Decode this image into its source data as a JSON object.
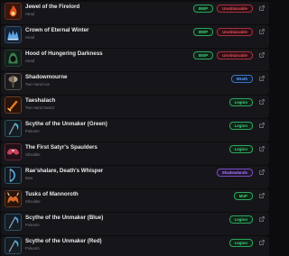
{
  "items": [
    {
      "name": "Jewel of the Firelord",
      "type": "Head",
      "badges": [
        {
          "label": "BWP",
          "color": "green"
        },
        {
          "label": "Unobtainable",
          "color": "red"
        }
      ],
      "icon": "flame-gem-icon",
      "accent": "#e0521f"
    },
    {
      "name": "Crown of Eternal Winter",
      "type": "Head",
      "badges": [
        {
          "label": "BWP",
          "color": "green"
        },
        {
          "label": "Unobtainable",
          "color": "red"
        }
      ],
      "icon": "frost-crown-icon",
      "accent": "#5fa8e8"
    },
    {
      "name": "Hood of Hungering Darkness",
      "type": "Head",
      "badges": [
        {
          "label": "BWP",
          "color": "green"
        },
        {
          "label": "Unobtainable",
          "color": "red"
        }
      ],
      "icon": "shadow-hood-icon",
      "accent": "#3b7d4a"
    },
    {
      "name": "Shadowmourne",
      "type": "Two Hand Axe",
      "badges": [
        {
          "label": "Wrath",
          "color": "blue"
        }
      ],
      "icon": "axe-icon",
      "accent": "#b8a58a"
    },
    {
      "name": "Taeshalach",
      "type": "Two Hand Sword",
      "badges": [
        {
          "label": "Legion",
          "color": "green"
        }
      ],
      "icon": "fire-sword-icon",
      "accent": "#e07a2a"
    },
    {
      "name": "Scythe of the Unmaker (Green)",
      "type": "Polearm",
      "badges": [
        {
          "label": "Legion",
          "color": "green"
        }
      ],
      "icon": "scythe-icon",
      "accent": "#4fb5c8"
    },
    {
      "name": "The First Satyr's Spaulders",
      "type": "Shoulder",
      "badges": [
        {
          "label": "Legion",
          "color": "green"
        }
      ],
      "icon": "spaulders-icon",
      "accent": "#c8405a"
    },
    {
      "name": "Rae'shalare, Death's Whisper",
      "type": "Bow",
      "badges": [
        {
          "label": "Shadowlands",
          "color": "purple"
        }
      ],
      "icon": "bow-icon",
      "accent": "#5fb8e8"
    },
    {
      "name": "Tusks of Mannoroth",
      "type": "Shoulder",
      "badges": [
        {
          "label": "MoP",
          "color": "green"
        }
      ],
      "icon": "tusks-icon",
      "accent": "#d8682a"
    },
    {
      "name": "Scythe of the Unmaker (Blue)",
      "type": "Polearm",
      "badges": [
        {
          "label": "Legion",
          "color": "green"
        }
      ],
      "icon": "scythe-icon",
      "accent": "#4fa0d8"
    },
    {
      "name": "Scythe of the Unmaker (Red)",
      "type": "Polearm",
      "badges": [
        {
          "label": "Legion",
          "color": "green"
        }
      ],
      "icon": "scythe-icon",
      "accent": "#4fa8d0"
    }
  ],
  "external_link_icon": "external-link-icon",
  "colors": {
    "background": "#0c0c0e",
    "row": "#16161a",
    "green": "#3fd07a",
    "red": "#e64a5a",
    "blue": "#5aa6ff",
    "purple": "#b07cff"
  }
}
